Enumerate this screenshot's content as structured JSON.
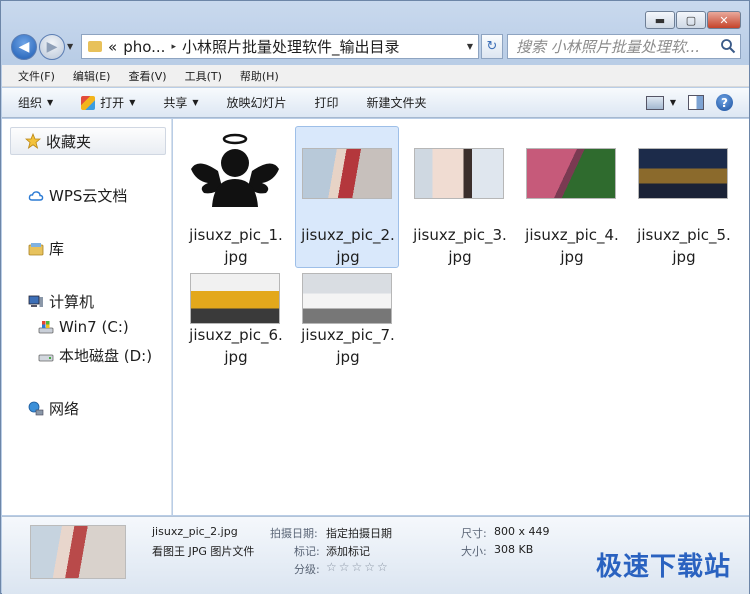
{
  "window": {
    "caption_minimize": "▬",
    "caption_maximize": "▢",
    "caption_close": "✕"
  },
  "address": {
    "overflow": "«",
    "crumbs": [
      "pho...",
      "小林照片批量处理软件_输出目录"
    ],
    "separator": "▸",
    "dropdown": "▼",
    "refresh": "↻"
  },
  "search": {
    "placeholder": "搜索 小林照片批量处理软..."
  },
  "menubar": [
    "文件(F)",
    "编辑(E)",
    "查看(V)",
    "工具(T)",
    "帮助(H)"
  ],
  "toolbar": {
    "organize": "组织",
    "open": "打开",
    "share": "共享",
    "slideshow": "放映幻灯片",
    "print": "打印",
    "new_folder": "新建文件夹",
    "arrow": "▼",
    "help": "?"
  },
  "nav": {
    "favorites": "收藏夹",
    "wps": "WPS云文档",
    "library": "库",
    "computer": "计算机",
    "drive_c": "Win7 (C:)",
    "drive_d": "本地磁盘 (D:)",
    "network": "网络"
  },
  "files": [
    {
      "line1": "jisuxz_pic_1.",
      "line2": "jpg"
    },
    {
      "line1": "jisuxz_pic_2.",
      "line2": "jpg"
    },
    {
      "line1": "jisuxz_pic_3.",
      "line2": "jpg"
    },
    {
      "line1": "jisuxz_pic_4.",
      "line2": "jpg"
    },
    {
      "line1": "jisuxz_pic_5.",
      "line2": "jpg"
    },
    {
      "line1": "jisuxz_pic_6.",
      "line2": "jpg"
    },
    {
      "line1": "jisuxz_pic_7.",
      "line2": "jpg"
    }
  ],
  "selected_index": 1,
  "details": {
    "name": "jisuxz_pic_2.jpg",
    "type": "看图王 JPG 图片文件",
    "date_key": "拍摄日期:",
    "date_val": "指定拍摄日期",
    "tags_key": "标记:",
    "tags_val": "添加标记",
    "rating_key": "分级:",
    "rating_stars": "☆☆☆☆☆",
    "dim_key": "尺寸:",
    "dim_val": "800 x 449",
    "size_key": "大小:",
    "size_val": "308 KB"
  },
  "watermark": "极速下载站",
  "colors": {
    "accent": "#2a62c0",
    "selection": "#d9e8fb"
  }
}
